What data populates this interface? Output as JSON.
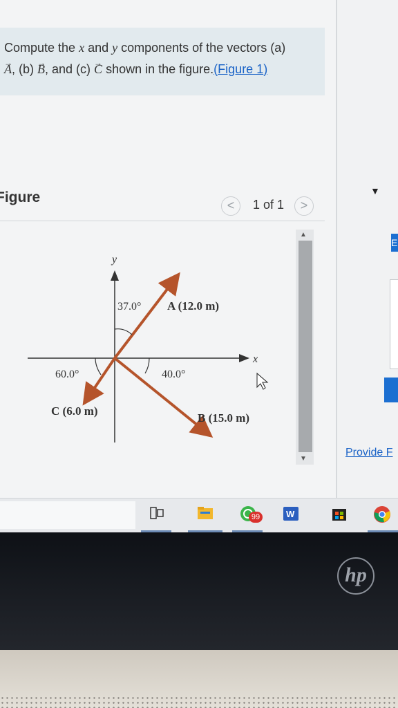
{
  "problem": {
    "text_1": "Compute the ",
    "var_x": "x",
    "text_2": " and ",
    "var_y": "y",
    "text_3": " components of the vectors (a)",
    "vec_a": "A",
    "text_4": ", (b) ",
    "vec_b": "B",
    "text_5": ", and (c) ",
    "vec_c": "C",
    "text_6": " shown in the figure.",
    "link_open": "(",
    "link_label": "Figure 1",
    "link_close": ")"
  },
  "figure_panel": {
    "title": "Figure",
    "pager_text": "1 of 1",
    "prev_glyph": "<",
    "next_glyph": ">"
  },
  "diagram": {
    "axis_x": "x",
    "axis_y": "y",
    "angle_a": "37.0°",
    "angle_b": "40.0°",
    "angle_c": "60.0°",
    "label_a": "A (12.0 m)",
    "label_b": "B (15.0 m)",
    "label_c": "C (6.0 m)",
    "vectors": [
      {
        "name": "A",
        "magnitude_m": 12.0,
        "angle_deg": 37.0,
        "reference": "from +y axis toward +x"
      },
      {
        "name": "B",
        "magnitude_m": 15.0,
        "angle_deg": 40.0,
        "reference": "below +x axis"
      },
      {
        "name": "C",
        "magnitude_m": 6.0,
        "angle_deg": 60.0,
        "reference": "below -x axis"
      }
    ],
    "vector_color": "#b5542b"
  },
  "right_panel": {
    "button_glyph": "E",
    "provide_link": "Provide F"
  },
  "taskbar": {
    "badge_count": "99",
    "word_letter": "W"
  },
  "bezel": {
    "logo": "hp"
  }
}
